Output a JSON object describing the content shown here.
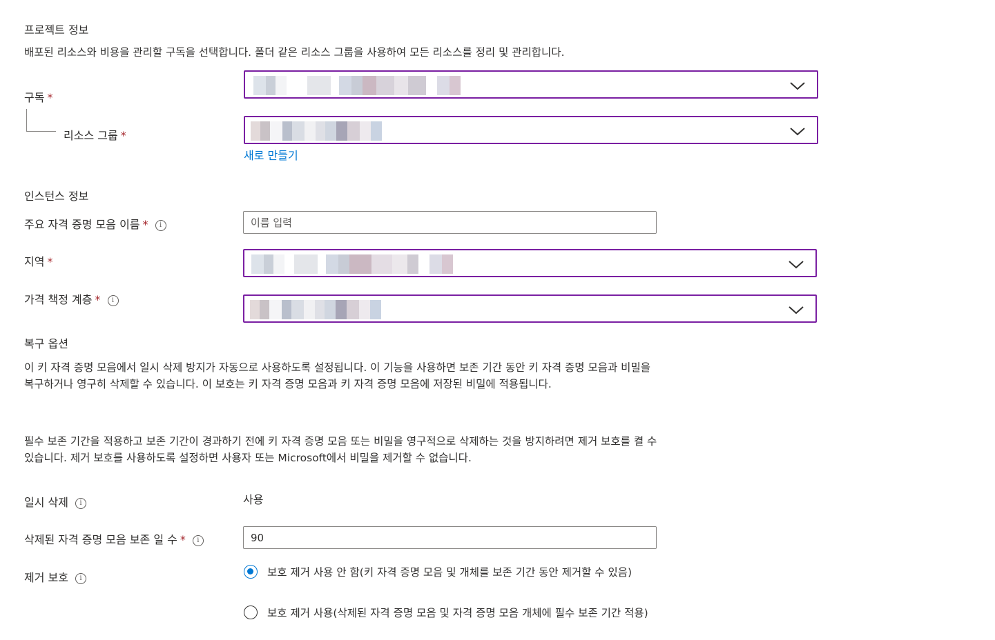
{
  "project": {
    "title": "프로젝트 정보",
    "description": "배포된 리소스와 비용을 관리할 구독을 선택합니다. 폴더 같은 리소스 그룹을 사용하여 모든 리소스를 정리 및 관리합니다.",
    "subscription_label": "구독",
    "resource_group_label": "리소스 그룹",
    "create_new": "새로 만들기"
  },
  "instance": {
    "title": "인스턴스 정보",
    "vault_name_label": "주요 자격 증명 모음 이름",
    "vault_name_placeholder": "이름 입력",
    "region_label": "지역",
    "pricing_tier_label": "가격 책정 계층"
  },
  "recovery": {
    "title": "복구 옵션",
    "paragraph1": "이 키 자격 증명 모음에서 일시 삭제 방지가 자동으로 사용하도록 설정됩니다. 이 기능을 사용하면 보존 기간 동안 키 자격 증명 모음과 비밀을 복구하거나 영구히 삭제할 수 있습니다. 이 보호는 키 자격 증명 모음과 키 자격 증명 모음에 저장된 비밀에 적용됩니다.",
    "paragraph2": "필수 보존 기간을 적용하고 보존 기간이 경과하기 전에 키 자격 증명 모음 또는 비밀을 영구적으로 삭제하는 것을 방지하려면 제거 보호를 켤 수 있습니다. 제거 보호를 사용하도록 설정하면 사용자 또는 Microsoft에서 비밀을 제거할 수 없습니다.",
    "soft_delete_label": "일시 삭제",
    "soft_delete_value": "사용",
    "retention_label": "삭제된 자격 증명 모음 보존 일 수",
    "retention_value": "90",
    "purge_label": "제거 보호",
    "purge_option_disable": "보호 제거 사용 안 함(키 자격 증명 모음 및 개체를 보존 기간 동안 제거할 수 있음)",
    "purge_option_enable": "보호 제거 사용(삭제된 자격 증명 모음 및 자격 증명 모음 개체에 필수 보존 기간 적용)"
  },
  "required_marker": "*",
  "info_glyph": "i",
  "colors": {
    "accent_border": "#7a1fa2",
    "link": "#0078d4",
    "required": "#a4262c"
  }
}
